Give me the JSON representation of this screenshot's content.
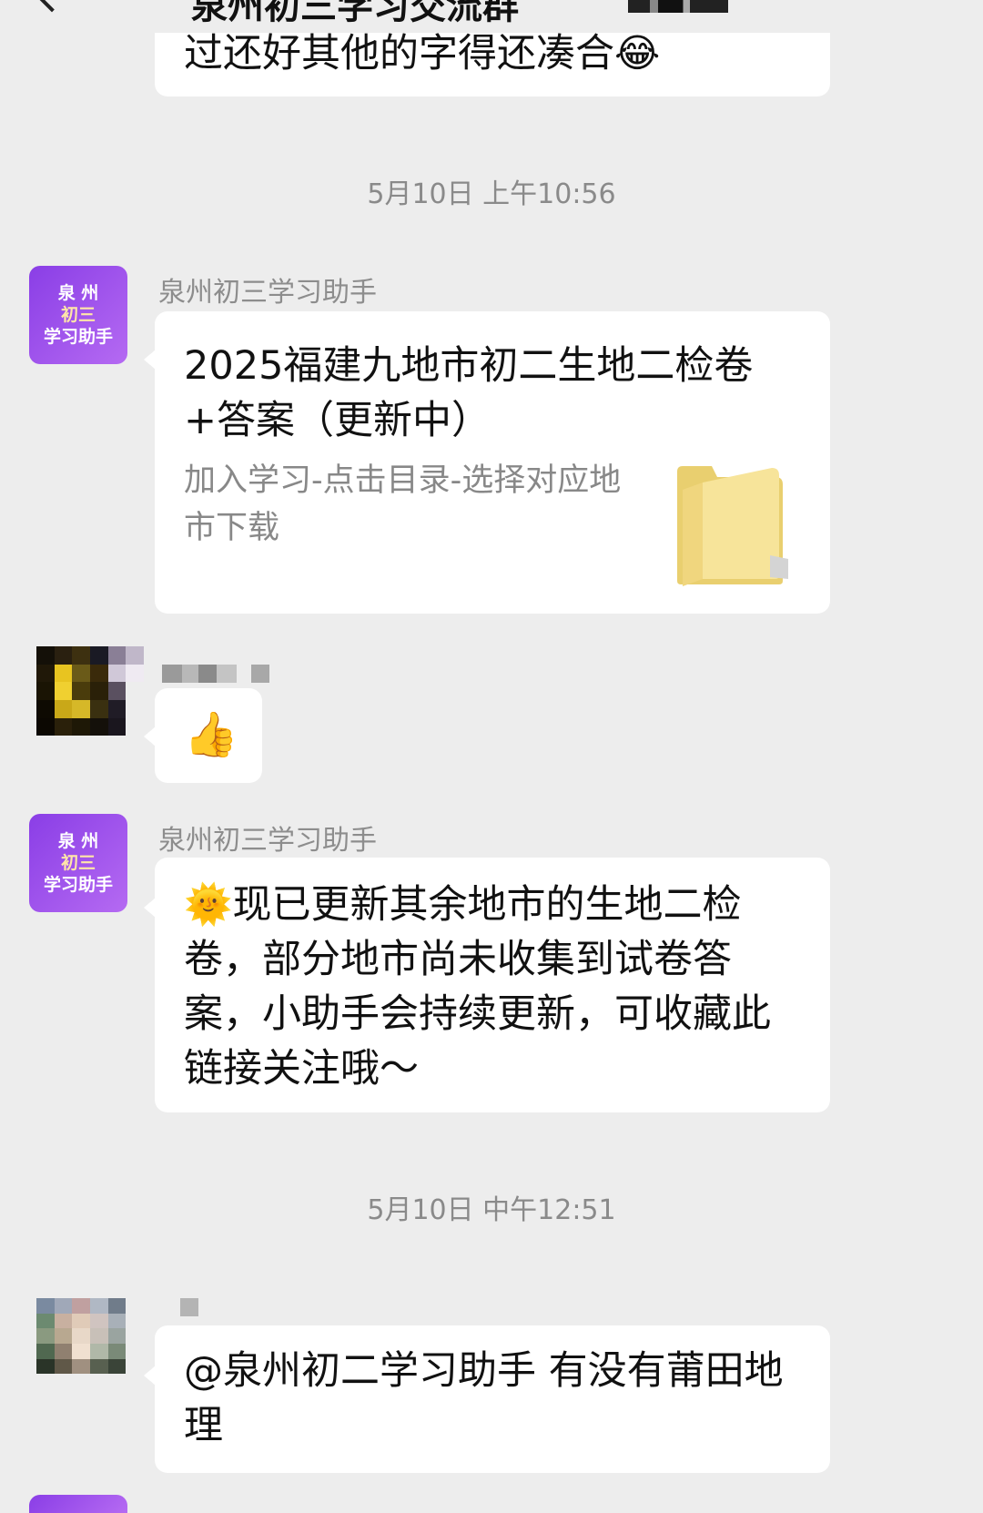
{
  "header": {
    "title": "泉州初三学习交流群"
  },
  "messages": [
    {
      "type": "text_partial",
      "text": "过还好其他的字得还凑合😂"
    },
    {
      "type": "time",
      "text": "5月10日 上午10:56"
    },
    {
      "type": "card",
      "sender": "泉州初三学习助手",
      "avatar_lines": [
        "泉 州",
        "初三",
        "学习助手"
      ],
      "title": "2025福建九地市初二生地二检卷+答案（更新中）",
      "desc": "加入学习-点击目录-选择对应地市下载",
      "thumb": "folder-icon"
    },
    {
      "type": "text",
      "sender_hidden": true,
      "text": "👍"
    },
    {
      "type": "text",
      "sender": "泉州初三学习助手",
      "avatar_lines": [
        "泉 州",
        "初三",
        "学习助手"
      ],
      "text": "🌞现已更新其余地市的生地二检卷，部分地市尚未收集到试卷答案，小助手会持续更新，可收藏此链接关注哦～"
    },
    {
      "type": "time",
      "text": "5月10日 中午12:51"
    },
    {
      "type": "text",
      "sender_hidden": true,
      "text": "@泉州初二学习助手  有没有莆田地理"
    }
  ]
}
